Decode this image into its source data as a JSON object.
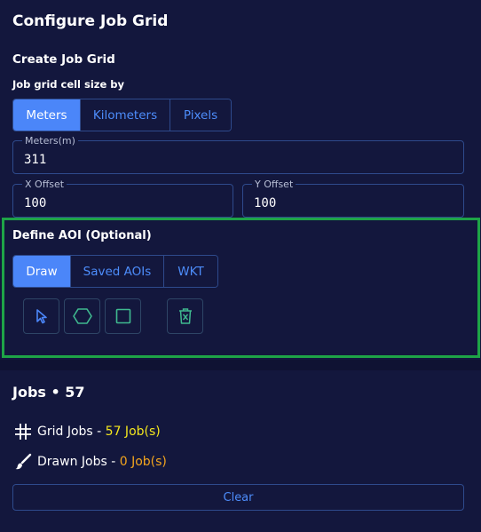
{
  "header": {
    "title": "Configure Job Grid"
  },
  "grid": {
    "subtitle": "Create Job Grid",
    "cell_size_label": "Job grid cell size by",
    "units": [
      "Meters",
      "Kilometers",
      "Pixels"
    ],
    "selected_unit": "Meters",
    "meters_label": "Meters(m)",
    "meters_value": "311",
    "x_offset_label": "X Offset",
    "x_offset_value": "100",
    "y_offset_label": "Y Offset",
    "y_offset_value": "100"
  },
  "aoi": {
    "title": "Define AOI (Optional)",
    "tabs": [
      "Draw",
      "Saved AOIs",
      "WKT"
    ],
    "selected_tab": "Draw",
    "tools": [
      {
        "icon": "pointer-cursor-icon"
      },
      {
        "icon": "hexagon-icon"
      },
      {
        "icon": "square-icon"
      },
      {
        "icon": "trash-icon"
      }
    ]
  },
  "jobs": {
    "title": "Jobs • 57",
    "grid_jobs_label": "Grid Jobs -",
    "grid_jobs_count": "57 Job(s)",
    "drawn_jobs_label": "Drawn Jobs -",
    "drawn_jobs_count": "0 Job(s)",
    "clear_label": "Clear"
  },
  "colors": {
    "background": "#13173d",
    "accent": "#4b86f9",
    "highlight_border": "#1ea447",
    "grid_count": "#f3e61e",
    "drawn_count": "#f3a51e"
  }
}
